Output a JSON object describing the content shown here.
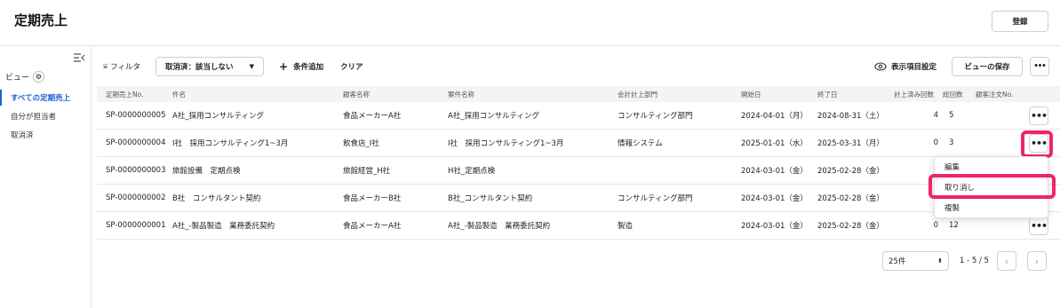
{
  "header": {
    "title": "定期売上",
    "register_label": "登録"
  },
  "sidebar": {
    "view_label": "ビュー",
    "items": [
      {
        "label": "すべての定期売上",
        "active": true
      },
      {
        "label": "自分が担当者",
        "active": false
      },
      {
        "label": "取消済",
        "active": false
      }
    ]
  },
  "toolbar": {
    "filter_label": "フィルタ",
    "filter_value": "取消済：該当しない",
    "add_condition_label": "条件追加",
    "clear_label": "クリア",
    "display_settings_label": "表示項目設定",
    "save_view_label": "ビューの保存",
    "more_label": "•••"
  },
  "table": {
    "columns": [
      "定期売上No.",
      "件名",
      "顧客名称",
      "案件名称",
      "会計計上部門",
      "開始日",
      "終了日",
      "計上済み回数",
      "総回数",
      "顧客注文No."
    ],
    "rows": [
      {
        "no": "SP-0000000005",
        "subject": "A社_採用コンサルティング",
        "customer": "食品メーカーA社",
        "project": "A社_採用コンサルティング",
        "dept": "コンサルティング部門",
        "start": "2024-04-01（月）",
        "end": "2024-08-31（土）",
        "posted": "4",
        "total": "5"
      },
      {
        "no": "SP-0000000004",
        "subject": "I社　採用コンサルティング1~3月",
        "customer": "飲食店_I社",
        "project": "I社　採用コンサルティング1~3月",
        "dept": "情報システム",
        "start": "2025-01-01（水）",
        "end": "2025-03-31（月）",
        "posted": "0",
        "total": "3"
      },
      {
        "no": "SP-0000000003",
        "subject": "旅館設備　定期点検",
        "customer": "旅館経営_H社",
        "project": "H社_定期点検",
        "dept": "",
        "start": "2024-03-01（金）",
        "end": "2025-02-28（金）",
        "posted": "",
        "total": ""
      },
      {
        "no": "SP-0000000002",
        "subject": "B社　コンサルタント契約",
        "customer": "食品メーカーB社",
        "project": "B社_コンサルタント契約",
        "dept": "コンサルティング部門",
        "start": "2024-03-01（金）",
        "end": "2025-02-28（金）",
        "posted": "",
        "total": ""
      },
      {
        "no": "SP-0000000001",
        "subject": "A社_-製品製造　業務委託契約",
        "customer": "食品メーカーA社",
        "project": "A社_-製品製造　業務委託契約",
        "dept": "製造",
        "start": "2024-03-01（金）",
        "end": "2025-02-28（金）",
        "posted": "0",
        "total": "12"
      }
    ]
  },
  "context_menu": {
    "items": [
      "編集",
      "取り消し",
      "複製"
    ]
  },
  "pagination": {
    "page_size": "25件",
    "range": "1 - 5 / 5"
  },
  "colors": {
    "accent": "#1a5fd6",
    "highlight": "#f0246b"
  }
}
